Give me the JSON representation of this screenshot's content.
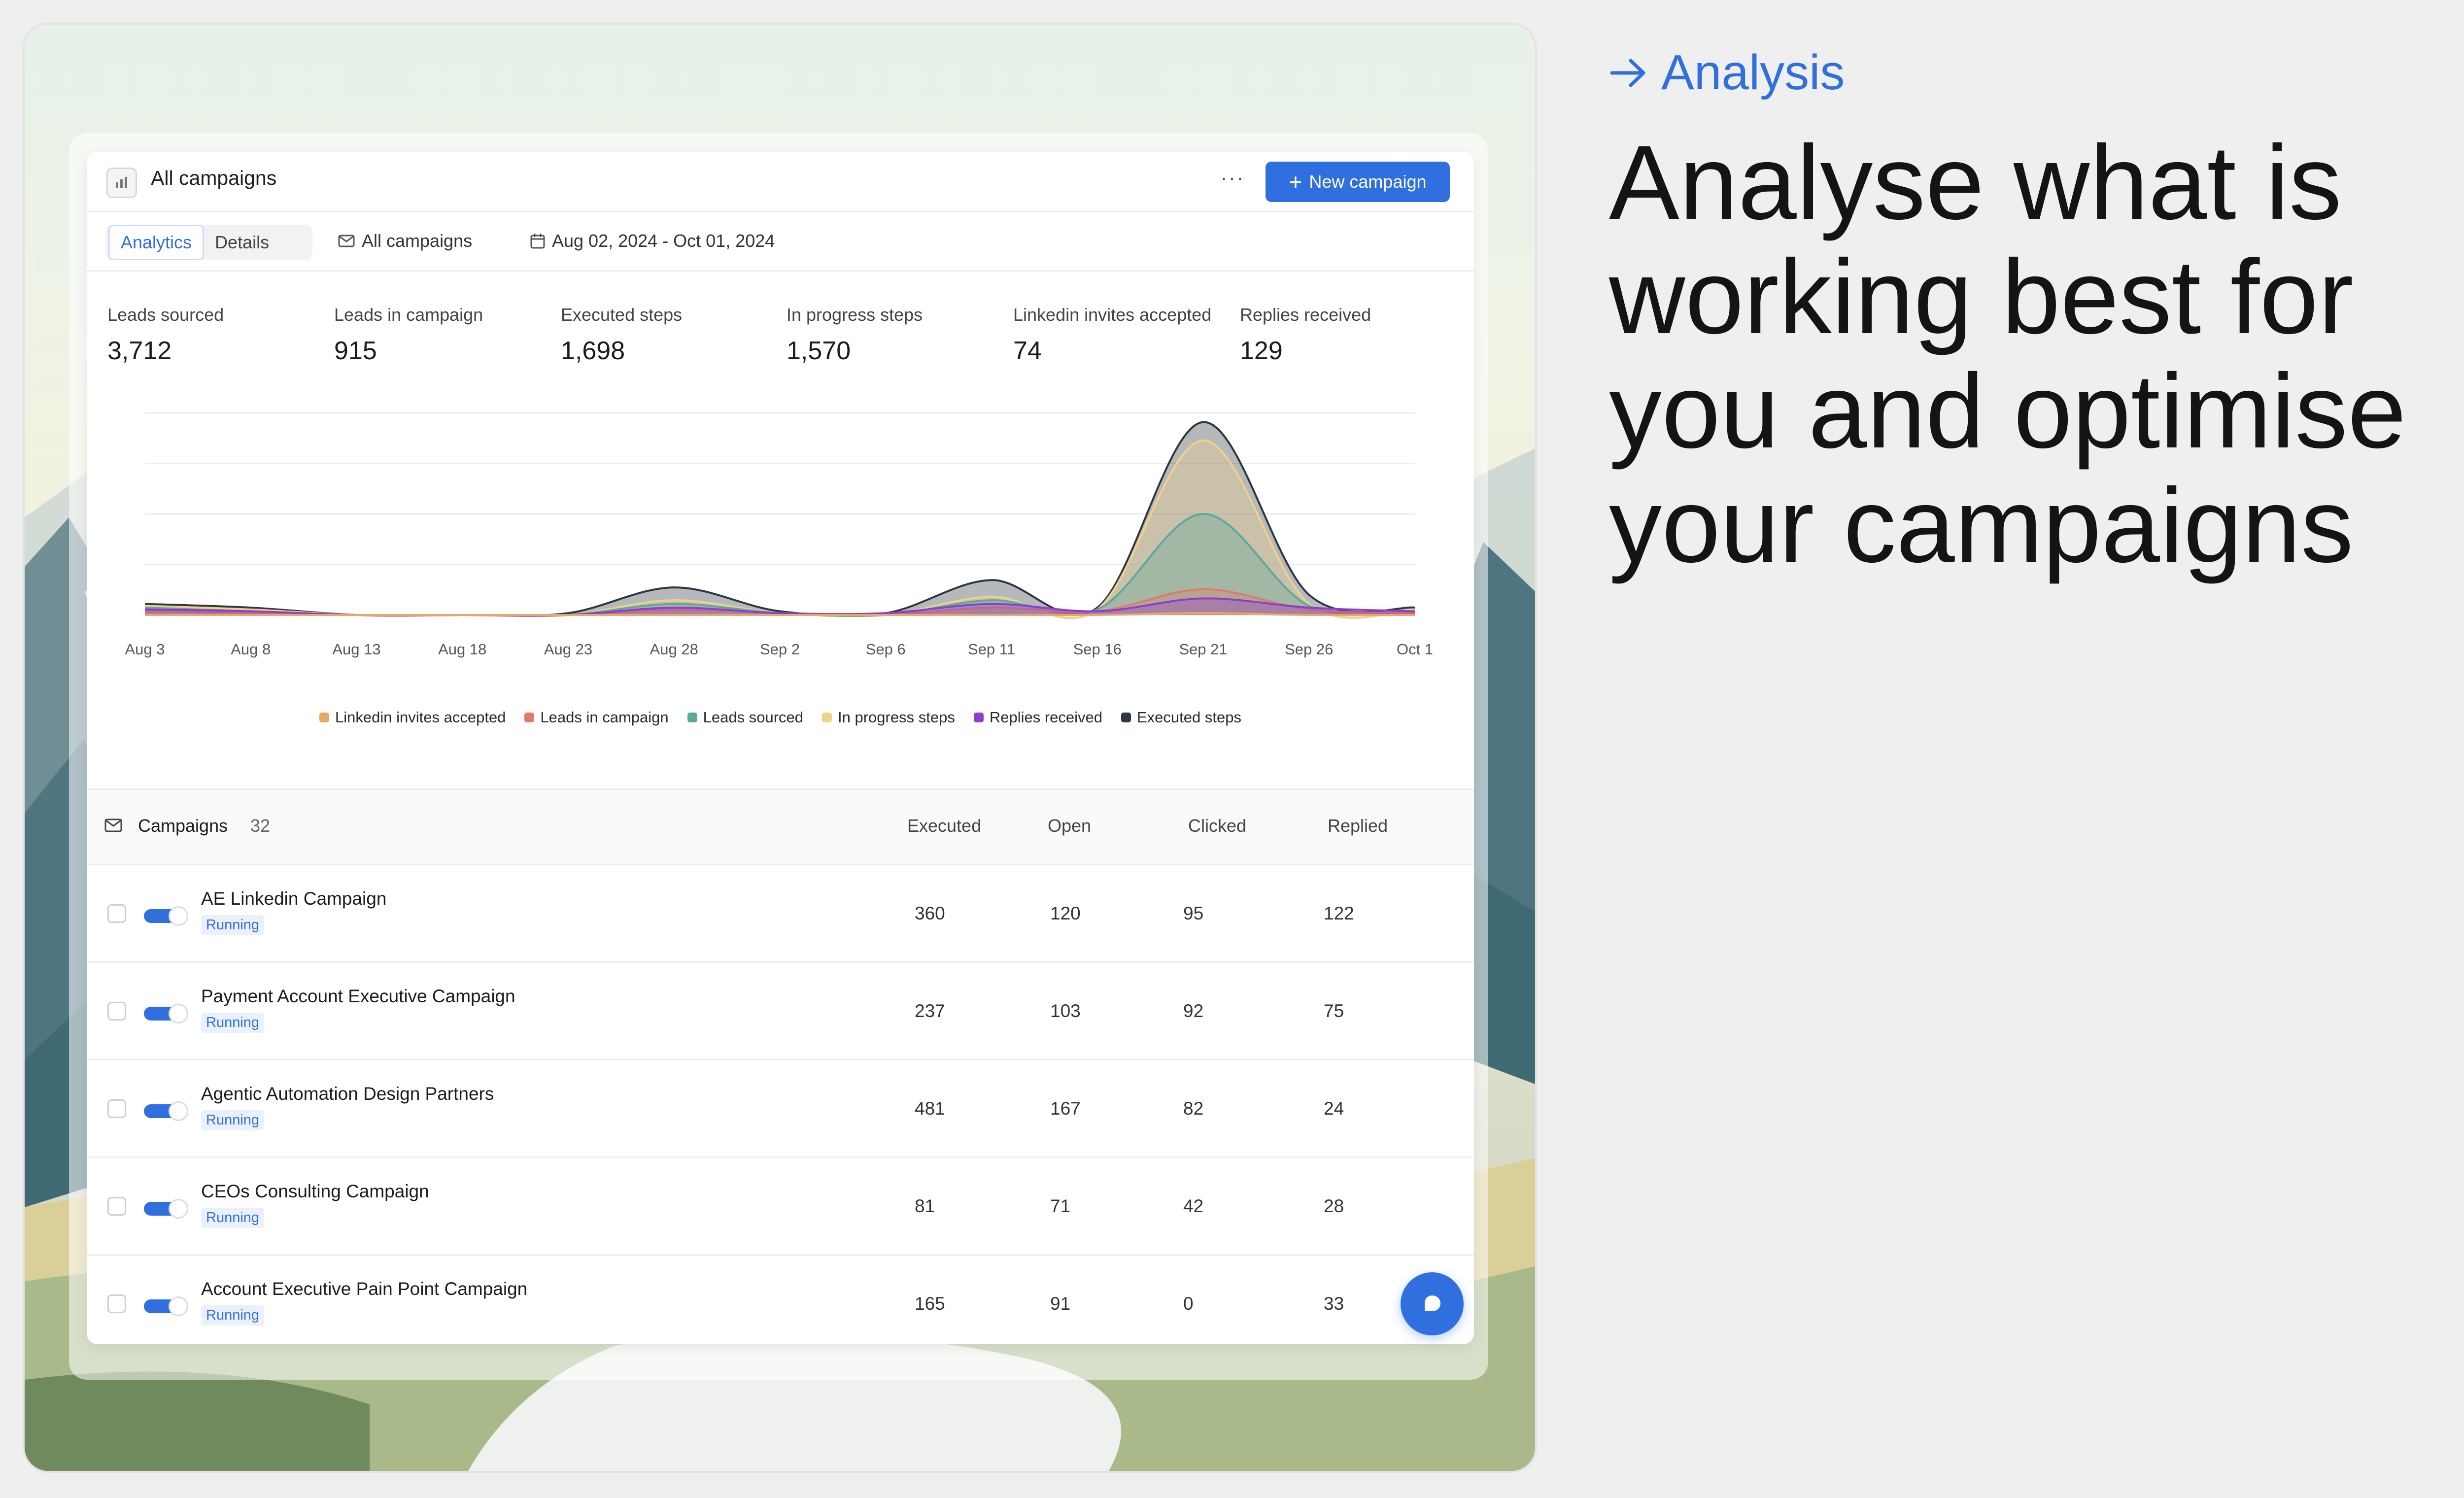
{
  "window": {
    "title": "All campaigns",
    "more_label": "···",
    "new_campaign_label": "New campaign"
  },
  "toolbar": {
    "tabs": [
      {
        "label": "Analytics",
        "active": true
      },
      {
        "label": "Details",
        "active": false
      }
    ],
    "campaign_filter": "All campaigns",
    "date_range": "Aug 02, 2024 - Oct 01, 2024"
  },
  "stats": [
    {
      "label": "Leads sourced",
      "value": "3,712"
    },
    {
      "label": "Leads in campaign",
      "value": "915"
    },
    {
      "label": "Executed steps",
      "value": "1,698"
    },
    {
      "label": "In progress steps",
      "value": "1,570"
    },
    {
      "label": "Linkedin invites accepted",
      "value": "74"
    },
    {
      "label": "Replies received",
      "value": "129"
    }
  ],
  "chart_data": {
    "type": "area",
    "x": [
      "Aug 3",
      "Aug 8",
      "Aug 13",
      "Aug 18",
      "Aug 23",
      "Aug 28",
      "Sep 2",
      "Sep 6",
      "Sep 11",
      "Sep 16",
      "Sep 21",
      "Sep 26",
      "Oct 1"
    ],
    "x_tick_labels": [
      "Aug 3",
      "Aug 8",
      "Aug 13",
      "Aug 18",
      "Aug 23",
      "Aug 28",
      "Sep 2",
      "Sep 6",
      "Sep 11",
      "Sep 16",
      "Sep 21",
      "Sep 26",
      "Oct 1"
    ],
    "series": [
      {
        "name": "Linkedin invites accepted",
        "color": "#e8a867",
        "values": [
          0,
          0,
          0,
          0,
          0,
          0,
          0,
          0,
          0,
          0,
          1,
          0,
          0
        ]
      },
      {
        "name": "Leads in campaign",
        "color": "#e07a6a",
        "values": [
          2,
          1,
          0,
          0,
          0,
          3,
          1,
          0,
          4,
          2,
          14,
          3,
          1
        ]
      },
      {
        "name": "Leads sourced",
        "color": "#5aa99a",
        "values": [
          4,
          2,
          0,
          0,
          0,
          6,
          1,
          0,
          8,
          3,
          55,
          5,
          2
        ]
      },
      {
        "name": "In progress steps",
        "color": "#efd28a",
        "values": [
          5,
          3,
          0,
          0,
          0,
          8,
          1,
          0,
          10,
          3,
          95,
          6,
          3
        ]
      },
      {
        "name": "Replies received",
        "color": "#8b3fcf",
        "values": [
          3,
          2,
          0,
          0,
          0,
          4,
          1,
          1,
          6,
          2,
          9,
          4,
          2
        ]
      },
      {
        "name": "Executed steps",
        "color": "#2f3740",
        "values": [
          6,
          4,
          0,
          0,
          1,
          15,
          2,
          1,
          19,
          4,
          105,
          11,
          4
        ]
      }
    ],
    "ylim": [
      0,
      110
    ],
    "grid": true,
    "legend": "bottom"
  },
  "table": {
    "title": "Campaigns",
    "count": "32",
    "columns": [
      "Executed",
      "Open",
      "Clicked",
      "Replied"
    ],
    "rows": [
      {
        "name": "AE Linkedin Campaign",
        "status": "Running",
        "executed": "360",
        "open": "120",
        "clicked": "95",
        "replied": "122"
      },
      {
        "name": "Payment Account Executive Campaign",
        "status": "Running",
        "executed": "237",
        "open": "103",
        "clicked": "92",
        "replied": "75"
      },
      {
        "name": "Agentic Automation Design Partners",
        "status": "Running",
        "executed": "481",
        "open": "167",
        "clicked": "82",
        "replied": "24"
      },
      {
        "name": "CEOs Consulting Campaign",
        "status": "Running",
        "executed": "81",
        "open": "71",
        "clicked": "42",
        "replied": "28"
      },
      {
        "name": "Account Executive Pain Point Campaign",
        "status": "Running",
        "executed": "165",
        "open": "91",
        "clicked": "0",
        "replied": "33"
      }
    ]
  },
  "promo": {
    "kicker": "Analysis",
    "headline": "Analyse what is working best for you and optimise your campaigns"
  },
  "colors": {
    "accent": "#2f6fde"
  }
}
